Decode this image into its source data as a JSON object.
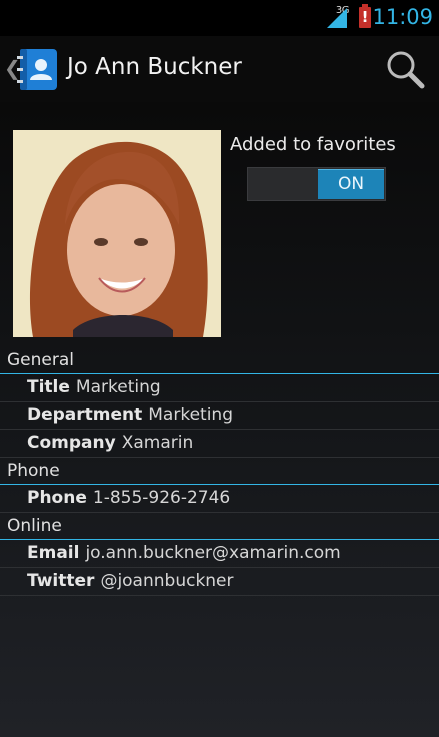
{
  "status_bar": {
    "network": "3G",
    "time": "11:09",
    "icons": [
      "signal-icon",
      "battery-alert-icon"
    ]
  },
  "action_bar": {
    "title": "Jo Ann Buckner",
    "app_icon": "contacts-book-icon",
    "search_icon": "search-icon"
  },
  "favorite": {
    "label": "Added to favorites",
    "toggle_text": "ON"
  },
  "sections": {
    "general": {
      "header": "General",
      "rows": [
        {
          "key": "Title",
          "value": "Marketing"
        },
        {
          "key": "Department",
          "value": "Marketing"
        },
        {
          "key": "Company",
          "value": "Xamarin"
        }
      ]
    },
    "phone": {
      "header": "Phone",
      "rows": [
        {
          "key": "Phone",
          "value": "1-855-926-2746"
        }
      ]
    },
    "online": {
      "header": "Online",
      "rows": [
        {
          "key": "Email",
          "value": "jo.ann.buckner@xamarin.com"
        },
        {
          "key": "Twitter",
          "value": "@joannbuckner"
        }
      ]
    }
  },
  "colors": {
    "accent": "#33b5e5",
    "toggle_on": "#1d84b8"
  }
}
